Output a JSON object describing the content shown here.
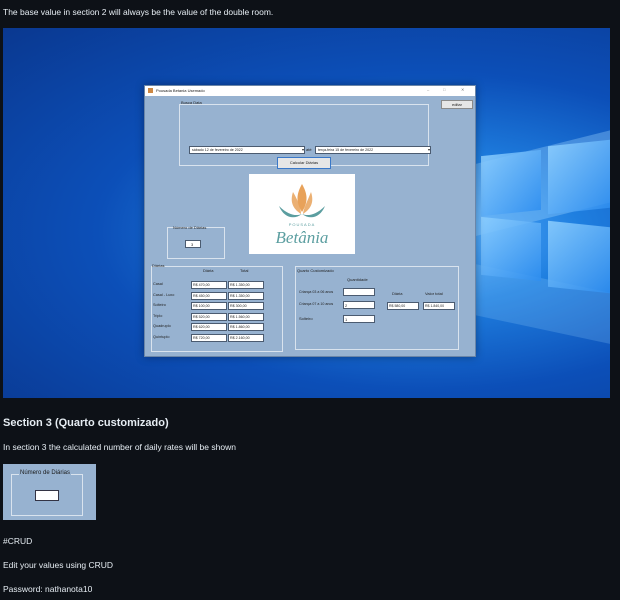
{
  "intro_text": "The base value in section 2 will always be the value of the double room.",
  "app": {
    "title": "Pousada Betania Usemado",
    "editar_label": "editar",
    "busca_data_label": "Busca Data",
    "date_from": "sábado    12 de fevereiro de 2022",
    "ate_label": "até",
    "date_to": "terça-feira   15 de fevereiro de 2022",
    "calcular_label": "Calcular Diárias",
    "logo_top": "POUSADA",
    "logo_name": "Betânia",
    "numero_diarias_label": "Número de Diárias",
    "numero_diarias_value": "3",
    "diarias_label": "Diárias",
    "col_diaria": "Diária",
    "col_total": "Total",
    "rooms": [
      {
        "name": "Casal",
        "diaria": "R$ 470,00",
        "total": "R$ 1.350,00"
      },
      {
        "name": "Casal - Luxo",
        "diaria": "R$ 450,00",
        "total": "R$ 1.350,00"
      },
      {
        "name": "Solteiro",
        "diaria": "R$ 100,00",
        "total": "R$ 300,00"
      },
      {
        "name": "Triplo",
        "diaria": "R$ 520,00",
        "total": "R$ 1.560,00"
      },
      {
        "name": "Quadruplo",
        "diaria": "R$ 620,00",
        "total": "R$ 1.860,00"
      },
      {
        "name": "Quíntuplo",
        "diaria": "R$ 720,00",
        "total": "R$ 2.160,00"
      }
    ],
    "quarto_custom_label": "Quarto Customizado",
    "quantidade_label": "Quantidade",
    "crianca_a_label": "Criança 03 a 06 anos",
    "crianca_a_value": "",
    "crianca_b_label": "Criança 07 a 10 anos",
    "crianca_b_value": "2",
    "solteiro_label": "Solteiro",
    "solteiro_value": "1",
    "custom_diaria_label": "Diária",
    "custom_total_label": "Valor total",
    "custom_diaria_value": "R$ 580,00",
    "custom_total_value": "R$ 1.840,00"
  },
  "section3_heading": "Section 3 (Quarto customizado)",
  "section3_text": "In section 3 the calculated number of daily rates will be shown",
  "thumb_label": "Número de Diárias",
  "crud_heading": "#CRUD",
  "crud_text": "Edit your values using CRUD",
  "password_text": "Password: nathanota10",
  "colors": {
    "page_bg": "#0d1117",
    "window_bg": "#97b2d0",
    "logo_orange": "#e8a25a",
    "logo_teal": "#5b9ea0"
  }
}
